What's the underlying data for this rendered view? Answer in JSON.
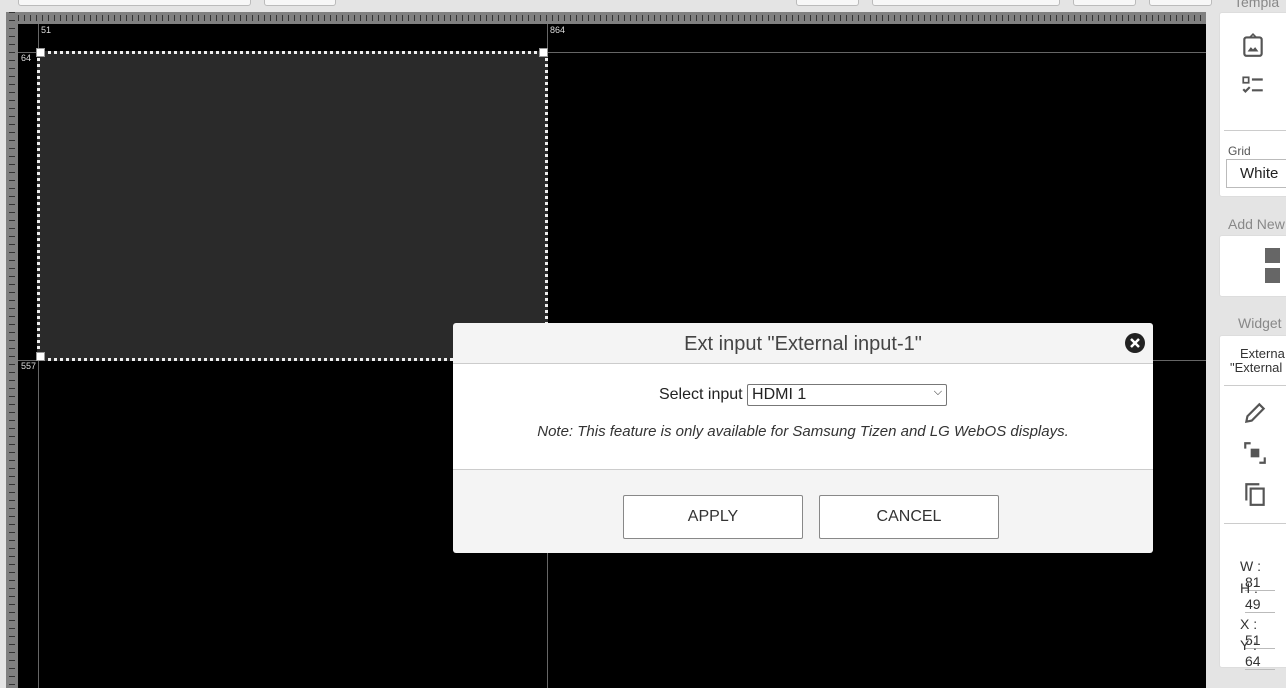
{
  "ruler_labels": {
    "x_left": "51",
    "x_right": "864",
    "y_top": "64",
    "y_bottom": "557"
  },
  "right_panel": {
    "templates_heading": "Templa",
    "grid_label": "Grid",
    "grid_value": "White",
    "add_new_heading": "Add New",
    "widget_heading": "Widget",
    "widget_name_line1": "Externa",
    "widget_name_line2": "\"External",
    "w_label": "W :",
    "w_value": "81",
    "h_label": "H :",
    "h_value": "49",
    "x_label": "X :",
    "x_value": "51",
    "y_label": "Y :",
    "y_value": "64"
  },
  "modal": {
    "title": "Ext input \"External input-1\"",
    "select_label": "Select input",
    "select_value": "HDMI 1",
    "note": "Note: This feature is only available for Samsung Tizen and LG WebOS displays.",
    "apply": "APPLY",
    "cancel": "CANCEL"
  }
}
